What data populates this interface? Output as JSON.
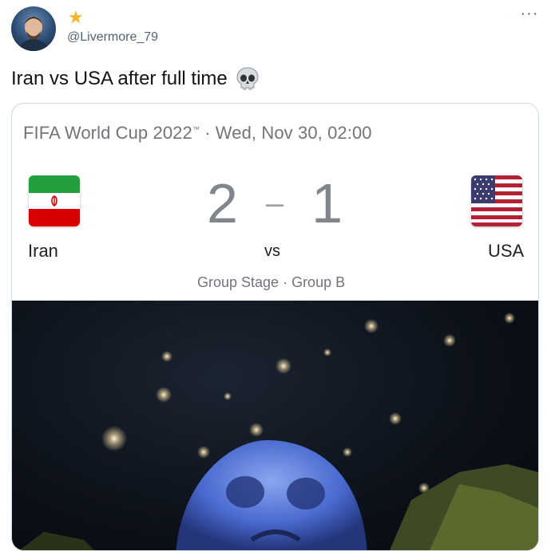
{
  "author": {
    "handle": "@Livermore_79",
    "star_glyph": "★"
  },
  "tweet": {
    "text": "Iran vs USA after full time",
    "emoji": "skull-icon"
  },
  "more_glyph": "···",
  "card": {
    "competition": "FIFA World Cup 2022",
    "tm": "™",
    "datetime": "· Wed, Nov 30, 02:00",
    "home_team": "Iran",
    "away_team": "USA",
    "home_score": "2",
    "score_separator": "–",
    "away_score": "1",
    "vs_label": "vs",
    "stage": "Group Stage · Group B"
  },
  "colors": {
    "accent_star": "#f5b327",
    "muted_text": "#70757a",
    "card_border": "#cfd9de"
  }
}
